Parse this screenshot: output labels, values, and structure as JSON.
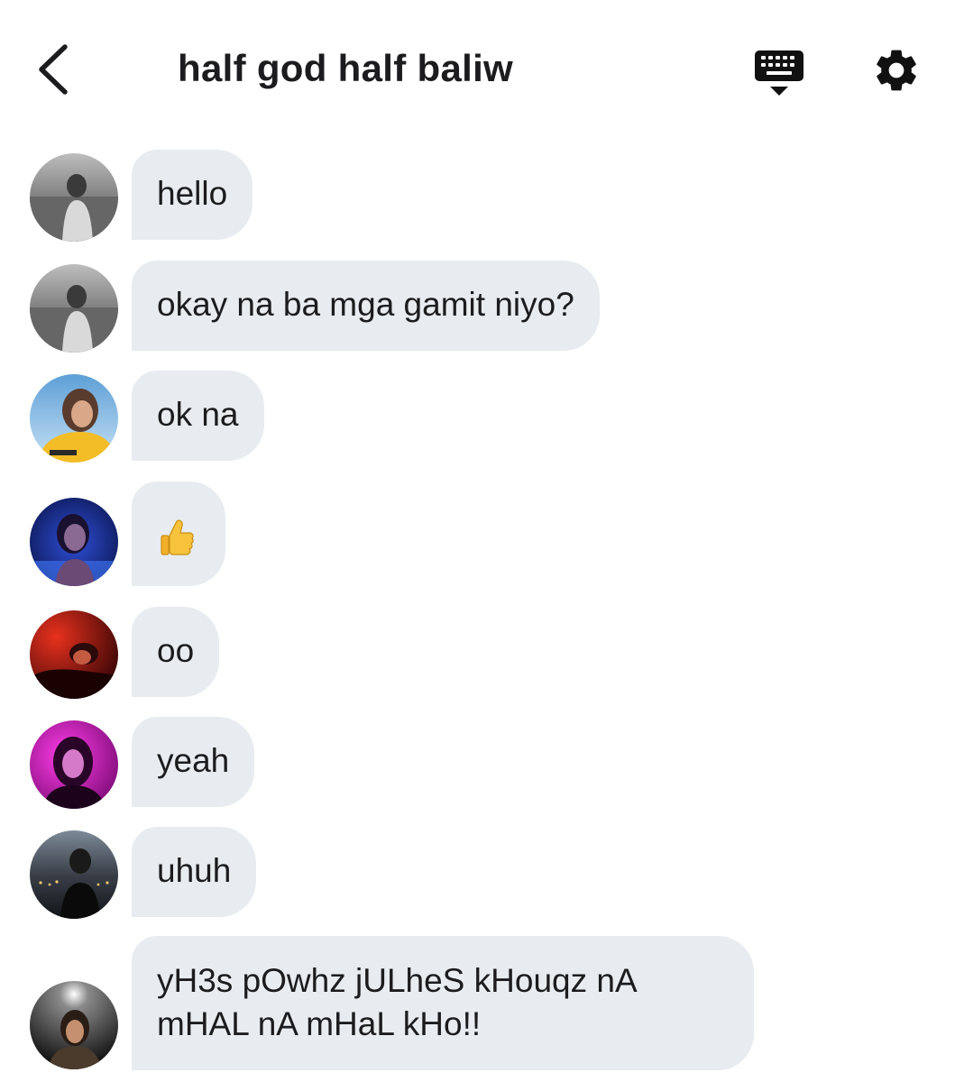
{
  "header": {
    "title": "half god half baliw",
    "back_icon": "chevron-left-icon",
    "keyboard_icon": "keyboard-icon",
    "settings_icon": "gear-icon"
  },
  "messages": [
    {
      "text": "hello",
      "avatar": "avatar-grayscale-field"
    },
    {
      "text": "okay na ba mga gamit niyo?",
      "avatar": "avatar-grayscale-field"
    },
    {
      "text": "ok na",
      "avatar": "avatar-yellow-shirt-sky"
    },
    {
      "text": "",
      "emoji": "thumbs-up-emoji",
      "avatar": "avatar-blue-pool"
    },
    {
      "text": "oo",
      "avatar": "avatar-red-light"
    },
    {
      "text": "yeah",
      "avatar": "avatar-pink-magenta"
    },
    {
      "text": "uhuh",
      "avatar": "avatar-night-city"
    },
    {
      "lines": [
        "yH3s pOwhz jULheS kHouqz nA",
        "mHAL nA mHaL kHo!!"
      ],
      "avatar": "avatar-dark-spotlight"
    }
  ],
  "colors": {
    "bubble_background": "#e8ecf0",
    "text": "#1c1c1e",
    "page_background": "#ffffff"
  }
}
